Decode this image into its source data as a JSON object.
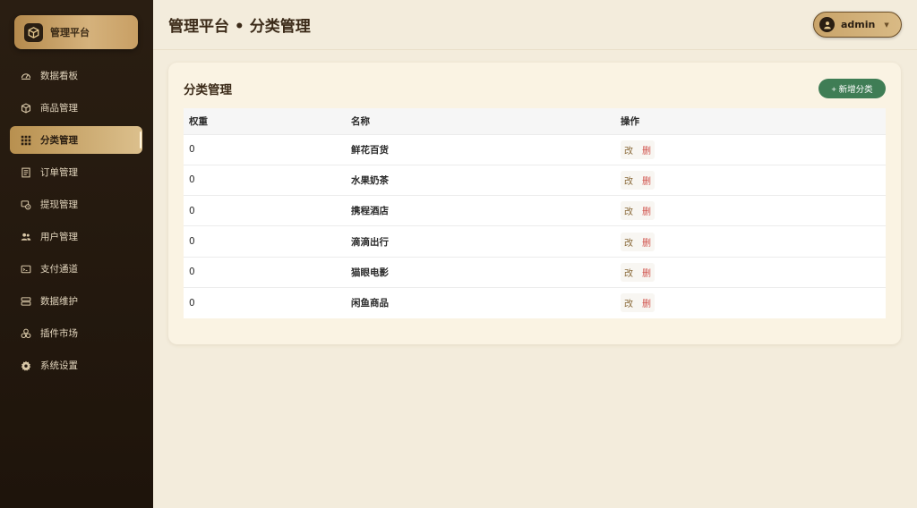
{
  "brand": {
    "title": "管理平台",
    "icon": "box-icon"
  },
  "sidebar": {
    "items": [
      {
        "label": "数据看板",
        "icon": "dashboard-icon",
        "active": false
      },
      {
        "label": "商品管理",
        "icon": "cube-icon",
        "active": false
      },
      {
        "label": "分类管理",
        "icon": "grid-icon",
        "active": true
      },
      {
        "label": "订单管理",
        "icon": "receipt-icon",
        "active": false
      },
      {
        "label": "提现管理",
        "icon": "withdraw-icon",
        "active": false
      },
      {
        "label": "用户管理",
        "icon": "users-icon",
        "active": false
      },
      {
        "label": "支付通道",
        "icon": "payment-icon",
        "active": false
      },
      {
        "label": "数据维护",
        "icon": "database-icon",
        "active": false
      },
      {
        "label": "插件市场",
        "icon": "plugins-icon",
        "active": false
      },
      {
        "label": "系统设置",
        "icon": "gear-icon",
        "active": false
      }
    ]
  },
  "header": {
    "title": "管理平台 • 分类管理",
    "user": {
      "name": "admin",
      "icon": "user-icon"
    }
  },
  "card": {
    "title": "分类管理",
    "add_label": "+ 新增分类",
    "columns": [
      "权重",
      "名称",
      "操作"
    ],
    "rows": [
      {
        "weight": "0",
        "name": "鲜花百货"
      },
      {
        "weight": "0",
        "name": "水果奶茶"
      },
      {
        "weight": "0",
        "name": "携程酒店"
      },
      {
        "weight": "0",
        "name": "滴滴出行"
      },
      {
        "weight": "0",
        "name": "猫眼电影"
      },
      {
        "weight": "0",
        "name": "闲鱼商品"
      }
    ],
    "edit_label": "改",
    "delete_label": "删"
  },
  "colors": {
    "accent_gold": "#c9a46a",
    "sidebar_bg": "#231810",
    "add_button": "#3f7d55",
    "delete_text": "#d0504a"
  }
}
